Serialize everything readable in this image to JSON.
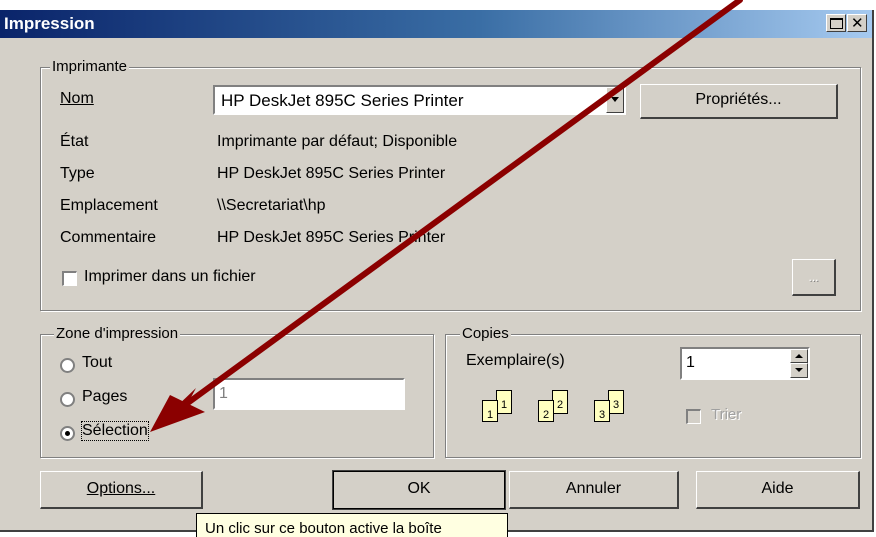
{
  "window": {
    "title": "Impression"
  },
  "printer": {
    "legend": "Imprimante",
    "name_label": "Nom",
    "name_value": "HP DeskJet 895C Series Printer",
    "properties_button": "Propriétés...",
    "status_label": "État",
    "status_value": "Imprimante par défaut; Disponible",
    "type_label": "Type",
    "type_value": "HP DeskJet 895C Series Printer",
    "location_label": "Emplacement",
    "location_value": "\\\\Secretariat\\hp",
    "comment_label": "Commentaire",
    "comment_value": "HP DeskJet 895C Series Printer",
    "print_to_file_label": "Imprimer dans un fichier",
    "browse_button": "..."
  },
  "range": {
    "legend": "Zone d'impression",
    "all_label": "Tout",
    "pages_label": "Pages",
    "pages_value": "1",
    "selection_label": "Sélection",
    "selected": "selection"
  },
  "copies": {
    "legend": "Copies",
    "copies_label": "Exemplaire(s)",
    "copies_value": "1",
    "collate_label": "Trier",
    "page_numbers": [
      "1",
      "1",
      "2",
      "2",
      "3",
      "3"
    ]
  },
  "buttons": {
    "options": "Options...",
    "ok": "OK",
    "cancel": "Annuler",
    "help": "Aide"
  },
  "tooltip": "Un clic sur ce bouton active la boîte",
  "annotation": {
    "arrow_color": "#8b0000"
  }
}
